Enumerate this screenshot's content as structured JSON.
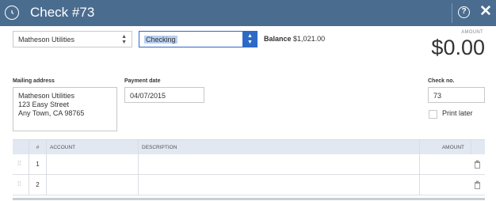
{
  "window": {
    "title": "Check #73",
    "help_label": "?",
    "close_label": "✕"
  },
  "payee": {
    "value": "Matheson Utilities"
  },
  "bank_account": {
    "value": "Checking"
  },
  "balance": {
    "label": "Balance",
    "value": "$1,021.00"
  },
  "amount": {
    "label": "AMOUNT",
    "value": "$0.00"
  },
  "mailing_address": {
    "label": "Mailing address",
    "lines": [
      "Matheson Utilities",
      "123 Easy Street",
      "Any Town, CA  98765"
    ]
  },
  "payment_date": {
    "label": "Payment date",
    "value": "04/07/2015"
  },
  "check_no": {
    "label": "Check no.",
    "value": "73"
  },
  "print_later": {
    "label": "Print later",
    "checked": false
  },
  "table": {
    "headers": [
      "#",
      "ACCOUNT",
      "DESCRIPTION",
      "AMOUNT"
    ],
    "rows": [
      {
        "num": "1",
        "account": "",
        "description": "",
        "amount": ""
      },
      {
        "num": "2",
        "account": "",
        "description": "",
        "amount": ""
      }
    ]
  },
  "icons": {
    "history": "history-icon",
    "help": "help-icon",
    "close": "close-icon",
    "drag": "drag-handle-icon",
    "trash": "trash-icon",
    "caret": "caret-updown-icon"
  },
  "colors": {
    "titlebar": "#4a6c8f",
    "accent": "#2d6ac6",
    "header_row": "#e1e8f2"
  }
}
